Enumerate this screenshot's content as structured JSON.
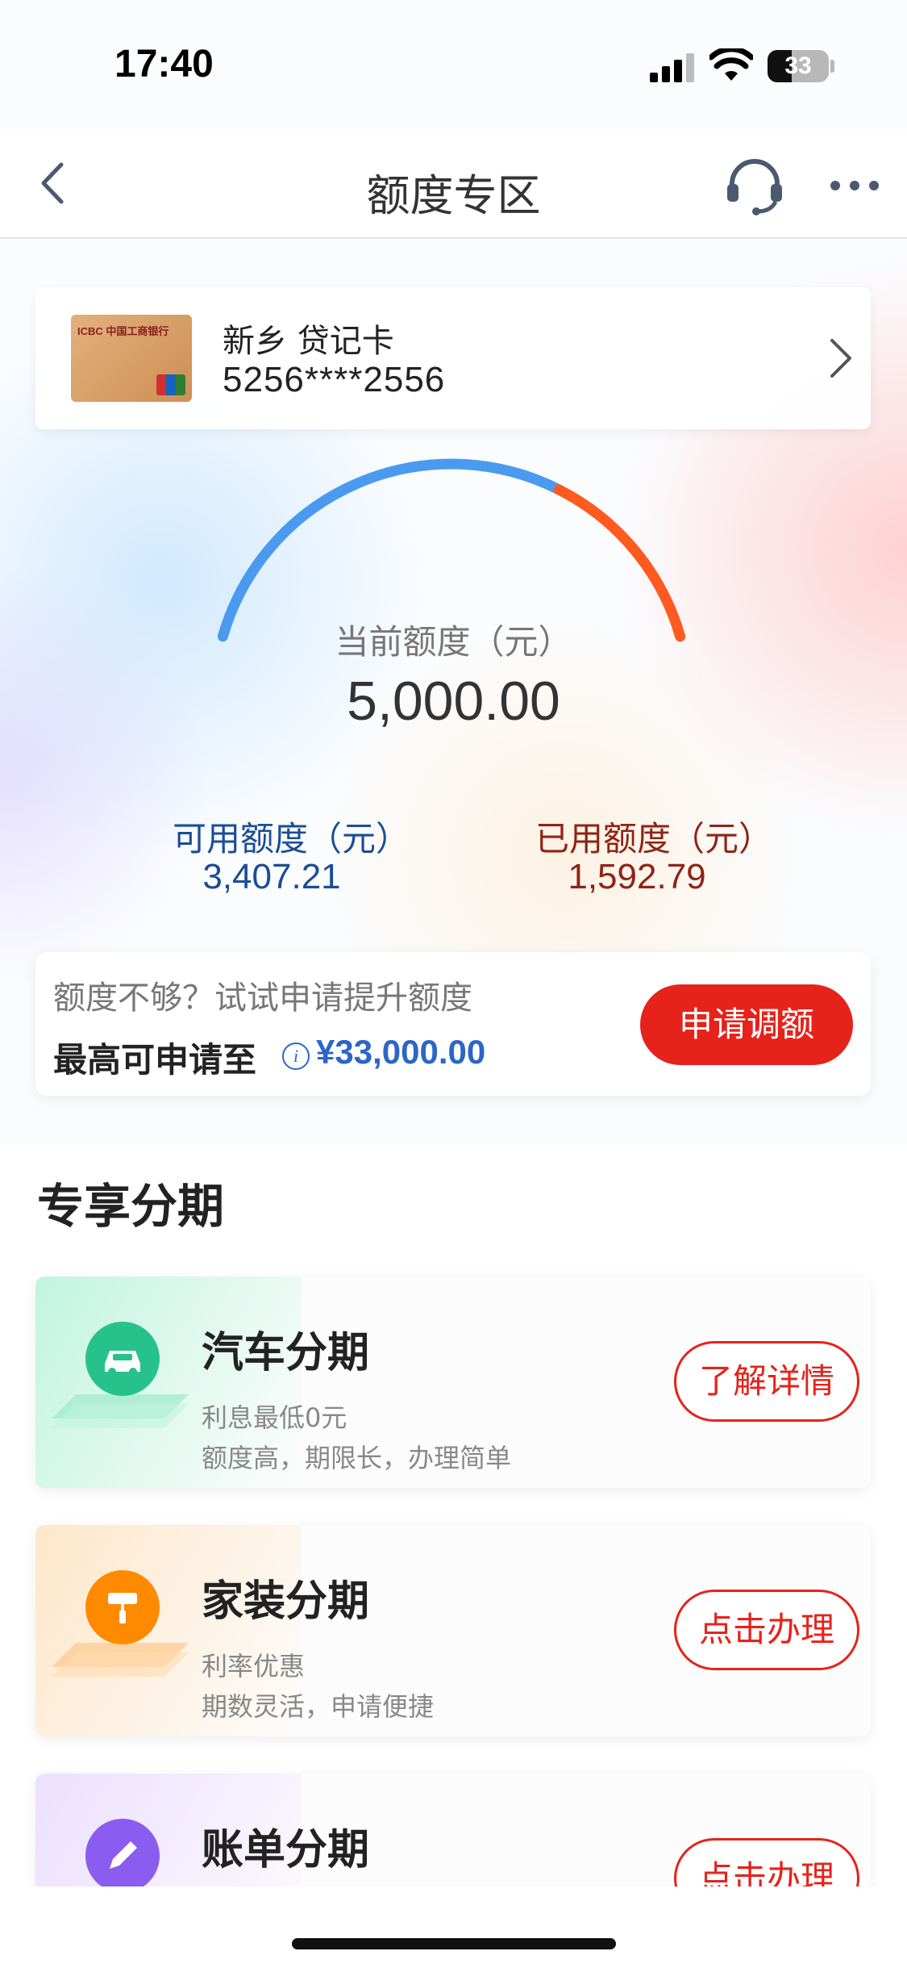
{
  "status_bar": {
    "time": "17:40",
    "battery": "33"
  },
  "nav": {
    "title": "额度专区"
  },
  "card": {
    "name": "新乡 贷记卡",
    "number": "5256****2556",
    "brand_text": "ICBC 中国工商银行"
  },
  "limit": {
    "current_label": "当前额度（元）",
    "current_value": "5,000.00",
    "available_label": "可用额度（元）",
    "available_value": "3,407.21",
    "used_label": "已用额度（元）",
    "used_value": "1,592.79",
    "used_fraction": 0.3186,
    "colors": {
      "available": "#4a9af0",
      "used": "#ff5a1f"
    }
  },
  "increase": {
    "prompt": "额度不够？试试申请提升额度",
    "max_label": "最高可申请至",
    "info_icon": "i",
    "max_value": "¥33,000.00",
    "button": "申请调额"
  },
  "section": {
    "title": "专享分期"
  },
  "plans": [
    {
      "icon": "car-icon",
      "title": "汽车分期",
      "line1": "利息最低0元",
      "line2": "额度高，期限长，办理简单",
      "button": "了解详情",
      "color": "#27c28c"
    },
    {
      "icon": "paint-roller-icon",
      "title": "家装分期",
      "line1": "利率优惠",
      "line2": "期数灵活，申请便捷",
      "button": "点击办理",
      "color": "#ff8a00"
    },
    {
      "icon": "pen-icon",
      "title": "账单分期",
      "line1": "",
      "line2": "",
      "button": "点击办理",
      "color": "#8a5cf0"
    }
  ]
}
